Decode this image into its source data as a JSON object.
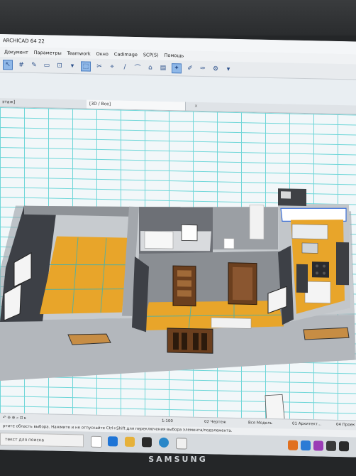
{
  "window": {
    "title": "ARCHICAD 64 22"
  },
  "menu": {
    "items": [
      "Документ",
      "Параметры",
      "Teamwork",
      "Окно",
      "Cadimage",
      "SCP(S)",
      "Помощь"
    ]
  },
  "tabs": {
    "left": "этаж]",
    "active": "[3D / Все]"
  },
  "status": {
    "scale": "1:100",
    "layer": "02 Чертеж",
    "model": "Вся Модель",
    "set": "01 Архитект...",
    "view": "04 Проек"
  },
  "hint": {
    "text": "ртите область выбора. Нажмите и не отпускайте Ctrl+Shift для переключения выбора элемента/подэлемента."
  },
  "taskbar": {
    "search_placeholder": "текст для поиска"
  },
  "monitor": {
    "brand": "SAMSUNG"
  },
  "colors": {
    "grid": "#6ed6d8",
    "floor": "#e8a52a",
    "wall": "#8f9297",
    "selection": "#8fb8e8"
  }
}
